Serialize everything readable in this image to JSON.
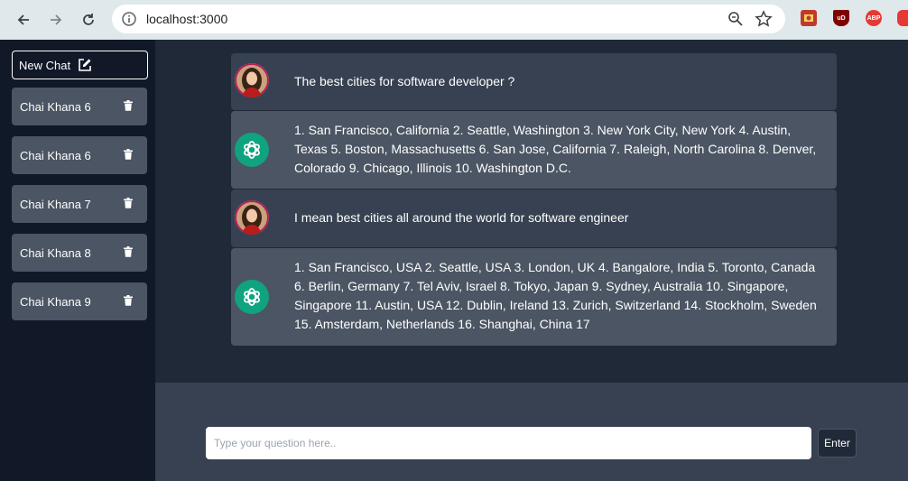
{
  "browser": {
    "url": "localhost:3000"
  },
  "sidebar": {
    "new_chat_label": "New Chat",
    "items": [
      {
        "label": "Chai Khana 6"
      },
      {
        "label": "Chai Khana 6"
      },
      {
        "label": "Chai Khana 7"
      },
      {
        "label": "Chai Khana 8"
      },
      {
        "label": "Chai Khana 9"
      }
    ]
  },
  "messages": [
    {
      "role": "user",
      "text": "The best cities for software developer ?"
    },
    {
      "role": "assistant",
      "text": "1. San Francisco, California 2. Seattle, Washington 3. New York City, New York 4. Austin, Texas 5. Boston, Massachusetts 6. San Jose, California 7. Raleigh, North Carolina 8. Denver, Colorado 9. Chicago, Illinois 10. Washington D.C."
    },
    {
      "role": "user",
      "text": "I mean best cities all around the world for software engineer"
    },
    {
      "role": "assistant",
      "text": "1. San Francisco, USA 2. Seattle, USA 3. London, UK 4. Bangalore, India 5. Toronto, Canada 6. Berlin, Germany 7. Tel Aviv, Israel 8. Tokyo, Japan 9. Sydney, Australia 10. Singapore, Singapore 11. Austin, USA 12. Dublin, Ireland 13. Zurich, Switzerland 14. Stockholm, Sweden 15. Amsterdam, Netherlands 16. Shanghai, China 17"
    }
  ],
  "input": {
    "placeholder": "Type your question here..",
    "value": "",
    "enter_label": "Enter"
  },
  "extensions": {
    "ublock_label": "uD",
    "abp_label": "ABP"
  },
  "colors": {
    "sidebar_bg": "#111827",
    "main_bg": "#1f2937",
    "user_msg_bg": "#374151",
    "bot_msg_bg": "#4b5563",
    "gpt_icon_bg": "#10a37f"
  }
}
